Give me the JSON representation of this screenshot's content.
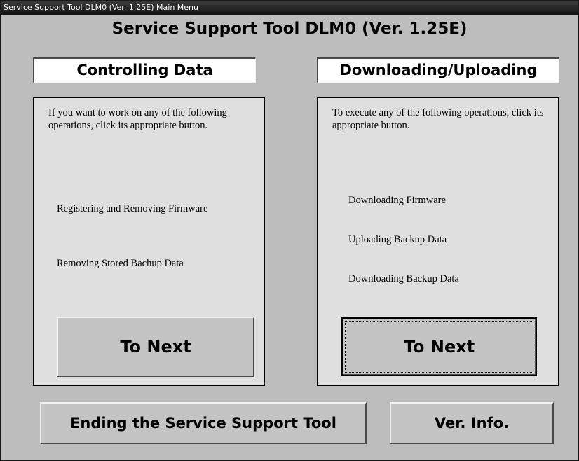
{
  "window": {
    "title": "Service Support Tool DLM0 (Ver. 1.25E)  Main Menu"
  },
  "main": {
    "heading": "Service Support Tool DLM0 (Ver. 1.25E)"
  },
  "controlling": {
    "header": "Controlling Data",
    "instruction": "If you want to work on any of the following operations, click its appropriate button.",
    "operations": [
      "Registering and Removing Firmware",
      "Removing Stored Bachup Data"
    ],
    "next_label": "To Next"
  },
  "downloading": {
    "header": "Downloading/Uploading",
    "instruction": "To execute any of the following operations, click its appropriate button.",
    "operations": [
      "Downloading Firmware",
      "Uploading Backup Data",
      "Downloading Backup Data"
    ],
    "next_label": "To Next"
  },
  "footer": {
    "end_label": "Ending the Service Support Tool",
    "version_label": "Ver. Info."
  }
}
